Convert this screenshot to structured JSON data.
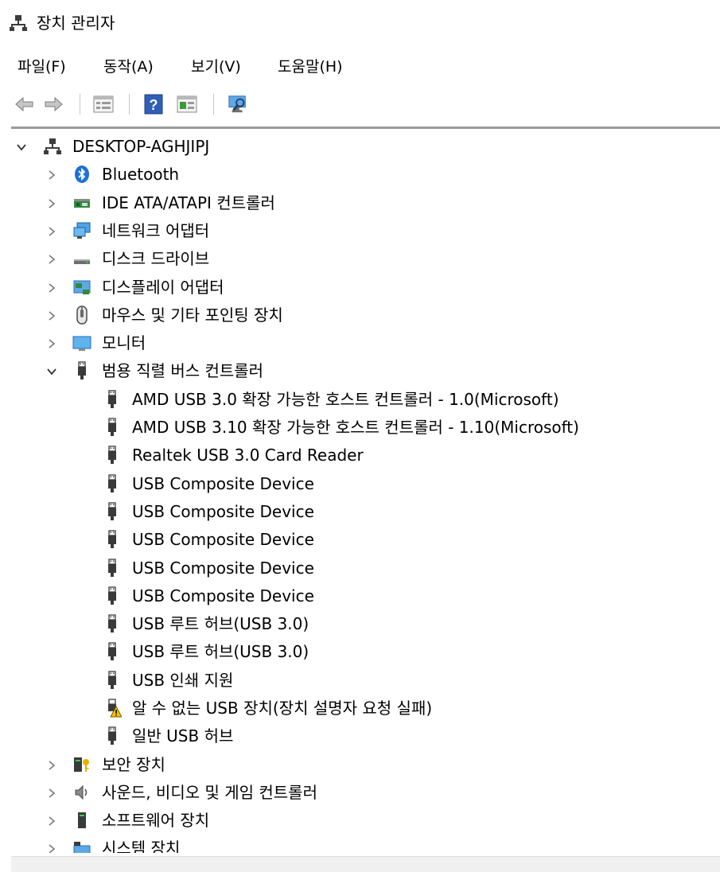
{
  "window": {
    "title": "장치 관리자"
  },
  "menu": [
    {
      "id": "file",
      "label": "파일(F)"
    },
    {
      "id": "action",
      "label": "동작(A)"
    },
    {
      "id": "view",
      "label": "보기(V)"
    },
    {
      "id": "help",
      "label": "도움말(H)"
    }
  ],
  "toolbar": [
    {
      "id": "back",
      "icon": "back-arrow-icon"
    },
    {
      "id": "forward",
      "icon": "forward-arrow-icon"
    },
    {
      "id": "properties",
      "icon": "properties-icon"
    },
    {
      "id": "help",
      "icon": "help-icon"
    },
    {
      "id": "update-driver",
      "icon": "update-driver-icon"
    },
    {
      "id": "scan",
      "icon": "scan-hardware-icon"
    }
  ],
  "tree": {
    "root": {
      "label": "DESKTOP-AGHJIPJ",
      "icon": "computer-icon",
      "expanded": true
    },
    "categories": [
      {
        "label": "Bluetooth",
        "icon": "bluetooth-icon"
      },
      {
        "label": "IDE ATA/ATAPI 컨트롤러",
        "icon": "ide-controller-icon"
      },
      {
        "label": "네트워크 어댑터",
        "icon": "network-adapter-icon"
      },
      {
        "label": "디스크 드라이브",
        "icon": "disk-drive-icon"
      },
      {
        "label": "디스플레이 어댑터",
        "icon": "display-adapter-icon"
      },
      {
        "label": "마우스 및 기타 포인팅 장치",
        "icon": "mouse-icon"
      },
      {
        "label": "모니터",
        "icon": "monitor-icon"
      },
      {
        "label": "범용 직렬 버스 컨트롤러",
        "icon": "usb-icon",
        "expanded": true,
        "children": [
          {
            "label": "AMD USB 3.0 확장 가능한 호스트 컨트롤러 - 1.0(Microsoft)",
            "icon": "usb-icon"
          },
          {
            "label": "AMD USB 3.10 확장 가능한 호스트 컨트롤러 - 1.10(Microsoft)",
            "icon": "usb-icon"
          },
          {
            "label": "Realtek USB 3.0 Card Reader",
            "icon": "usb-icon"
          },
          {
            "label": "USB Composite Device",
            "icon": "usb-icon"
          },
          {
            "label": "USB Composite Device",
            "icon": "usb-icon"
          },
          {
            "label": "USB Composite Device",
            "icon": "usb-icon"
          },
          {
            "label": "USB Composite Device",
            "icon": "usb-icon"
          },
          {
            "label": "USB Composite Device",
            "icon": "usb-icon"
          },
          {
            "label": "USB 루트 허브(USB 3.0)",
            "icon": "usb-icon"
          },
          {
            "label": "USB 루트 허브(USB 3.0)",
            "icon": "usb-icon"
          },
          {
            "label": "USB 인쇄 지원",
            "icon": "usb-icon"
          },
          {
            "label": "알 수 없는 USB 장치(장치 설명자 요청 실패)",
            "icon": "usb-warning-icon"
          },
          {
            "label": "일반 USB 허브",
            "icon": "usb-icon"
          }
        ]
      },
      {
        "label": "보안 장치",
        "icon": "security-device-icon"
      },
      {
        "label": "사운드, 비디오 및 게임 컨트롤러",
        "icon": "sound-icon"
      },
      {
        "label": "소프트웨어 장치",
        "icon": "software-device-icon"
      },
      {
        "label": "시스템 장치",
        "icon": "system-device-icon"
      }
    ]
  }
}
